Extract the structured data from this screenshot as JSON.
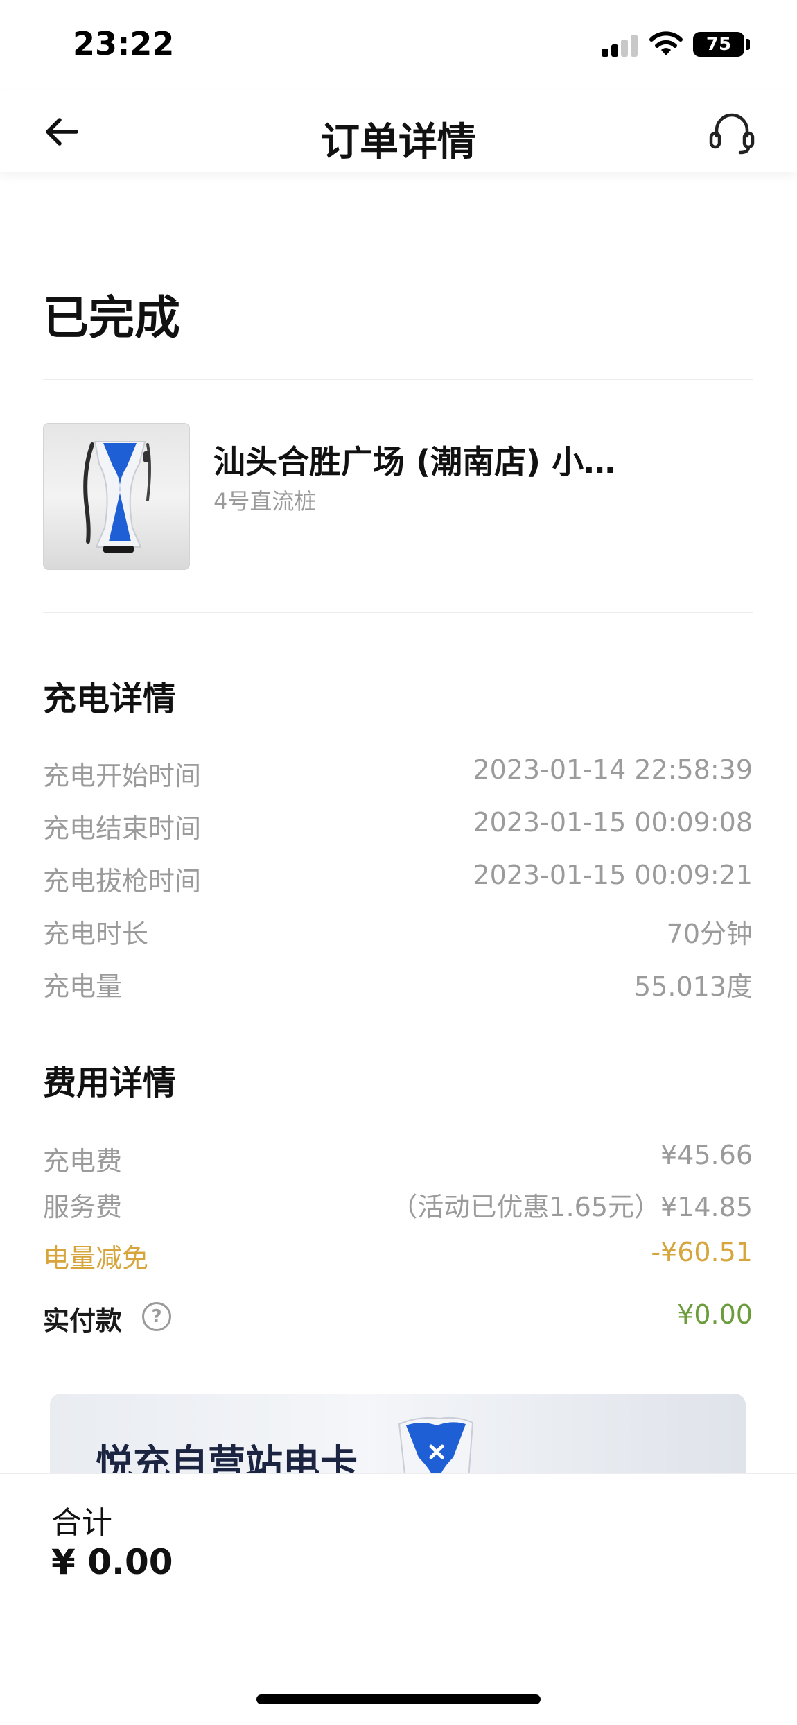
{
  "status_bar": {
    "time": "23:22",
    "battery": "75"
  },
  "nav": {
    "title": "订单详情",
    "back_icon": "arrow-left-icon",
    "support_icon": "headset-icon"
  },
  "order": {
    "status": "已完成"
  },
  "station": {
    "name": "汕头合胜广场 (潮南店) 小…",
    "pile": "4号直流桩",
    "image": "charging-pile-image"
  },
  "charge_details": {
    "title": "充电详情",
    "rows": [
      {
        "label": "充电开始时间",
        "value": "2023-01-14 22:58:39"
      },
      {
        "label": "充电结束时间",
        "value": "2023-01-15 00:09:08"
      },
      {
        "label": "充电拔枪时间",
        "value": "2023-01-15 00:09:21"
      },
      {
        "label": "充电时长",
        "value": "70分钟"
      },
      {
        "label": "充电量",
        "value": "55.013度"
      }
    ]
  },
  "fee_details": {
    "title": "费用详情",
    "charge_fee": {
      "label": "充电费",
      "value": "¥45.66"
    },
    "service_fee": {
      "label": "服务费",
      "value": "（活动已优惠1.65元）¥14.85"
    },
    "discount": {
      "label": "电量减免",
      "value": "-¥60.51"
    },
    "paid": {
      "label": "实付款",
      "value": "¥0.00",
      "help": "?"
    }
  },
  "banner": {
    "title": "悦充自营站电卡"
  },
  "footer": {
    "total_label": "合计",
    "total_value": "¥ 0.00"
  },
  "colors": {
    "gold": "#d6a63c",
    "green": "#6c9c3c",
    "pile_blue": "#1f5fd6"
  }
}
